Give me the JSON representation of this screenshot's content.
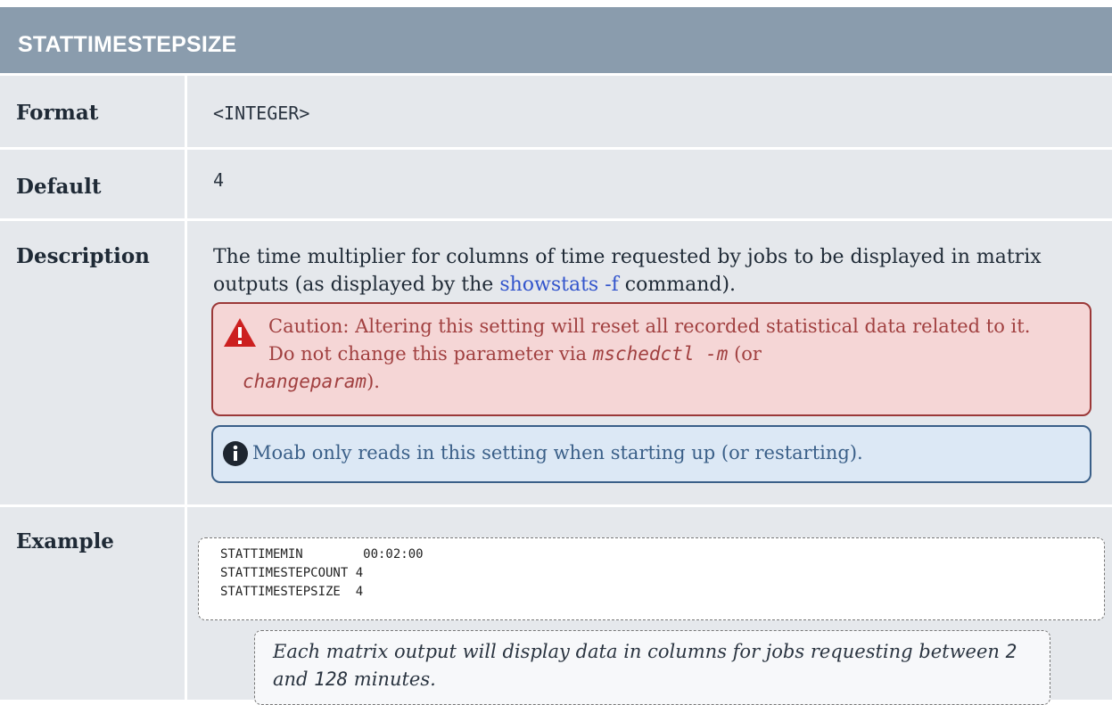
{
  "title": "STATTIMESTEPSIZE",
  "rows": {
    "format": {
      "label": "Format",
      "value": "<INTEGER>"
    },
    "default": {
      "label": "Default",
      "value": "4"
    },
    "description": {
      "label": "Description",
      "text_before": "The time multiplier for columns of time requested by jobs to be displayed in matrix outputs (as displayed by the ",
      "link_text": "showstats -f",
      "text_after": " command).",
      "caution": {
        "icon": "warning-triangle-icon",
        "text_line1": "Caution: Altering this setting will reset all recorded statistical data related to it. Do not change this parameter via ",
        "code1": "mschedctl -m",
        "text_mid": " (or",
        "code2": "changeparam",
        "text_end": ")."
      },
      "note": {
        "icon": "info-circle-icon",
        "text": "Moab only reads in this setting when starting up (or restarting)."
      }
    },
    "example": {
      "label": "Example",
      "code_lines": [
        "STATTIMEMIN        00:02:00",
        "STATTIMESTEPCOUNT 4",
        "STATTIMESTEPSIZE  4"
      ],
      "explanation": {
        "text1": "Each matrix output will display data in columns for jobs requesting between ",
        "num1": "2",
        "text2": " and ",
        "num2": "128",
        "text3": " minutes."
      }
    }
  },
  "colors": {
    "header_bg": "#8a9cad",
    "cell_bg": "#e5e8ec",
    "caution_bg": "#f5d6d6",
    "caution_border": "#9b3838",
    "note_bg": "#dce8f5",
    "note_border": "#3a5f88",
    "link": "#3355cc"
  }
}
